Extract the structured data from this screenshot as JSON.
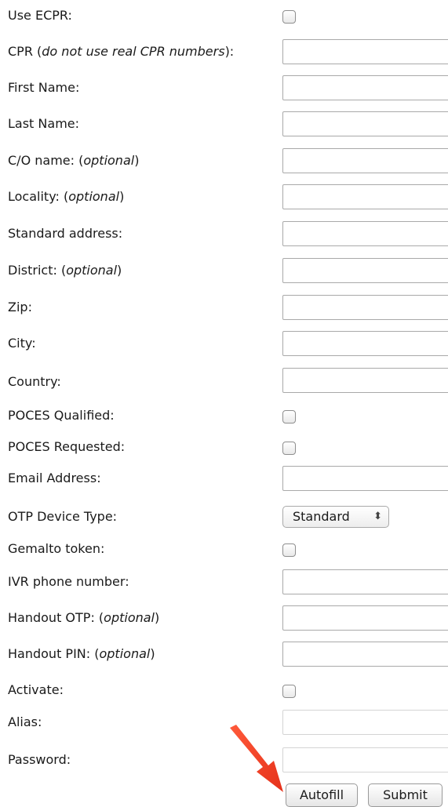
{
  "form": {
    "use_ecpr": {
      "label": "Use ECPR:"
    },
    "cpr": {
      "label_prefix": "CPR (",
      "label_em": "do not use real CPR numbers",
      "label_suffix": "):",
      "value": ""
    },
    "first_name": {
      "label": "First Name:",
      "value": ""
    },
    "last_name": {
      "label": "Last Name:",
      "value": ""
    },
    "co_name": {
      "label_prefix": "C/O name: (",
      "label_em": "optional",
      "label_suffix": ")",
      "value": ""
    },
    "locality": {
      "label_prefix": "Locality: (",
      "label_em": "optional",
      "label_suffix": ")",
      "value": ""
    },
    "standard_address": {
      "label": "Standard address:",
      "value": ""
    },
    "district": {
      "label_prefix": "District: (",
      "label_em": "optional",
      "label_suffix": ")",
      "value": ""
    },
    "zip": {
      "label": "Zip:",
      "value": ""
    },
    "city": {
      "label": "City:",
      "value": ""
    },
    "country": {
      "label": "Country:",
      "value": ""
    },
    "poces_qualified": {
      "label": "POCES Qualified:"
    },
    "poces_requested": {
      "label": "POCES Requested:"
    },
    "email": {
      "label": "Email Address:",
      "value": ""
    },
    "otp_device_type": {
      "label": "OTP Device Type:",
      "selected": "Standard"
    },
    "gemalto_token": {
      "label": "Gemalto token:"
    },
    "ivr_phone": {
      "label": "IVR phone number:",
      "value": ""
    },
    "handout_otp": {
      "label_prefix": "Handout OTP: (",
      "label_em": "optional",
      "label_suffix": ")",
      "value": ""
    },
    "handout_pin": {
      "label_prefix": "Handout PIN: (",
      "label_em": "optional",
      "label_suffix": ")",
      "value": ""
    },
    "activate": {
      "label": "Activate:"
    },
    "alias": {
      "label": "Alias:",
      "value": ""
    },
    "password": {
      "label": "Password:",
      "value": ""
    }
  },
  "buttons": {
    "autofill": "Autofill",
    "submit": "Submit"
  },
  "colors": {
    "annotation_arrow": "#f23c1e"
  }
}
